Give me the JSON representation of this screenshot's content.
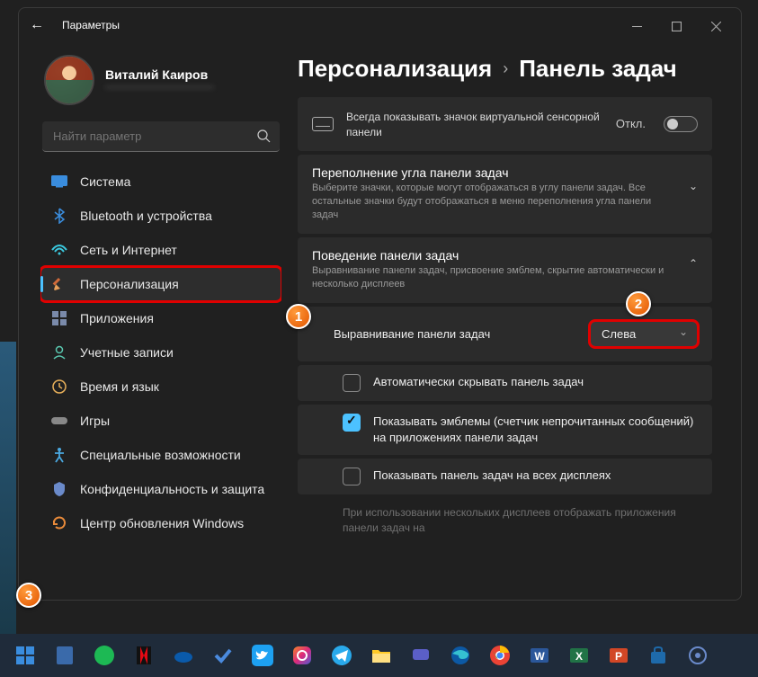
{
  "titlebar": {
    "app_title": "Параметры"
  },
  "profile": {
    "name": "Виталий Каиров",
    "email": "———————————"
  },
  "search": {
    "placeholder": "Найти параметр"
  },
  "sidebar": {
    "items": [
      {
        "label": "Система",
        "icon": "system"
      },
      {
        "label": "Bluetooth и устройства",
        "icon": "bluetooth"
      },
      {
        "label": "Сеть и Интернет",
        "icon": "network"
      },
      {
        "label": "Персонализация",
        "icon": "personalization",
        "active": true
      },
      {
        "label": "Приложения",
        "icon": "apps"
      },
      {
        "label": "Учетные записи",
        "icon": "accounts"
      },
      {
        "label": "Время и язык",
        "icon": "time"
      },
      {
        "label": "Игры",
        "icon": "gaming"
      },
      {
        "label": "Специальные возможности",
        "icon": "accessibility"
      },
      {
        "label": "Конфиденциальность и защита",
        "icon": "privacy"
      },
      {
        "label": "Центр обновления Windows",
        "icon": "update"
      }
    ]
  },
  "breadcrumb": {
    "level1": "Персонализация",
    "level2": "Панель задач"
  },
  "rows": {
    "touchpad": {
      "desc": "Всегда показывать значок виртуальной сенсорной панели",
      "toggle_state": "Откл."
    },
    "overflow": {
      "title": "Переполнение угла панели задач",
      "desc": "Выберите значки, которые могут отображаться в углу панели задач. Все остальные значки будут отображаться в меню переполнения угла панели задач"
    },
    "behavior": {
      "title": "Поведение панели задач",
      "desc": "Выравнивание панели задач, присвоение эмблем, скрытие автоматически и несколько дисплеев"
    },
    "alignment": {
      "label": "Выравнивание панели задач",
      "value": "Слева"
    },
    "autohide": {
      "label": "Автоматически скрывать панель задач"
    },
    "badges": {
      "label": "Показывать эмблемы (счетчик непрочитанных сообщений) на приложениях панели задач"
    },
    "all_displays": {
      "label": "Показывать панель задач на всех дисплеях"
    },
    "multi_note": "При использовании нескольких дисплеев отображать приложения панели задач на"
  },
  "markers": {
    "m1": "1",
    "m2": "2",
    "m3": "3"
  },
  "taskbar_apps": [
    "start",
    "calc",
    "spotify",
    "netflix",
    "onedrive",
    "todo",
    "twitter",
    "instagram",
    "telegram",
    "explorer",
    "chat",
    "edge",
    "chrome",
    "word",
    "excel",
    "pp",
    "store",
    "settings"
  ]
}
